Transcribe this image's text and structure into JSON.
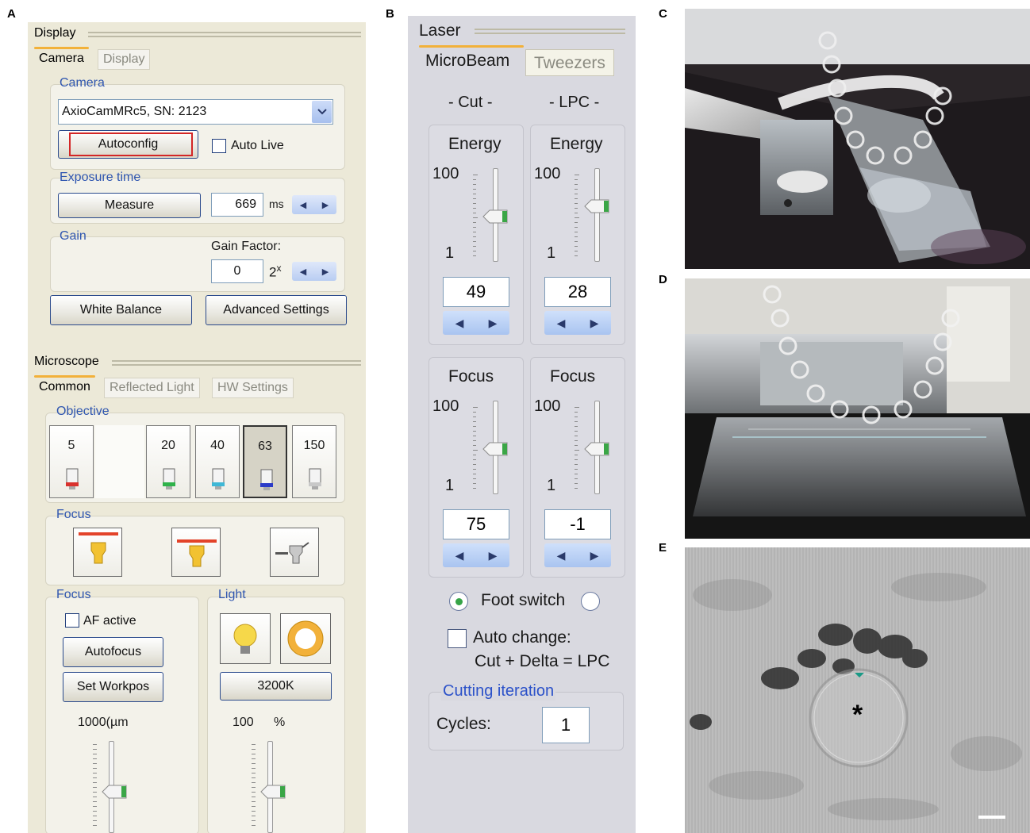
{
  "panel_letters": {
    "a": "A",
    "b": "B",
    "c": "C",
    "d": "D",
    "e": "E"
  },
  "panel_a": {
    "display_group": "Display",
    "tabs": [
      "Camera",
      "Display"
    ],
    "camera": {
      "label": "Camera",
      "camera_select": "AxioCamMRc5, SN: 2123",
      "autoconfig_button": "Autoconfig",
      "auto_live_label": "Auto Live"
    },
    "exposure": {
      "label": "Exposure time",
      "measure_button": "Measure",
      "value": "669",
      "unit": "ms"
    },
    "gain": {
      "label": "Gain",
      "factor_label": "Gain Factor:",
      "value": "0",
      "unit": "2",
      "unit_sup": "x"
    },
    "white_balance_button": "White Balance",
    "advanced_settings_button": "Advanced Settings",
    "microscope_group": "Microscope",
    "microscope_tabs": [
      "Common",
      "Reflected Light",
      "HW Settings"
    ],
    "objective": {
      "label": "Objective",
      "items": [
        {
          "mag": "5",
          "color": "#d9322e"
        },
        {
          "mag": "20",
          "color": "#2fb24a"
        },
        {
          "mag": "40",
          "color": "#3fb8d6"
        },
        {
          "mag": "63",
          "color": "#2b3bc8"
        },
        {
          "mag": "150",
          "color": "#c8c8c8"
        }
      ]
    },
    "focus_label": "Focus",
    "focus2_label": "Focus",
    "af_active_label": "AF active",
    "autofocus_button": "Autofocus",
    "set_workpos_button": "Set Workpos",
    "focus_value": "1000(",
    "focus_unit": "µm",
    "light_label": "Light",
    "color_temp_button": "3200K",
    "light_value": "100",
    "light_unit": "%"
  },
  "panel_b": {
    "laser_group": "Laser",
    "tabs": [
      "MicroBeam",
      "Tweezers"
    ],
    "cut_label": "- Cut -",
    "lpc_label": "- LPC -",
    "cut_energy": {
      "label": "Energy",
      "max": "100",
      "min": "1",
      "value": "49",
      "level": 0.49
    },
    "lpc_energy": {
      "label": "Energy",
      "max": "100",
      "min": "1",
      "value": "28",
      "level": 0.62
    },
    "cut_focus": {
      "label": "Focus",
      "max": "100",
      "min": "1",
      "value": "75",
      "level": 0.49
    },
    "lpc_focus": {
      "label": "Focus",
      "max": "100",
      "min": "1",
      "value": "-1",
      "level": 0.49
    },
    "foot_switch_label": "Foot switch",
    "auto_change_label": "Auto change:",
    "auto_change_formula": "Cut + Delta = LPC",
    "cutting_iteration_label": "Cutting iteration",
    "cycles_label": "Cycles:",
    "cycles_value": "1"
  },
  "panel_e": {
    "marker": "*"
  }
}
